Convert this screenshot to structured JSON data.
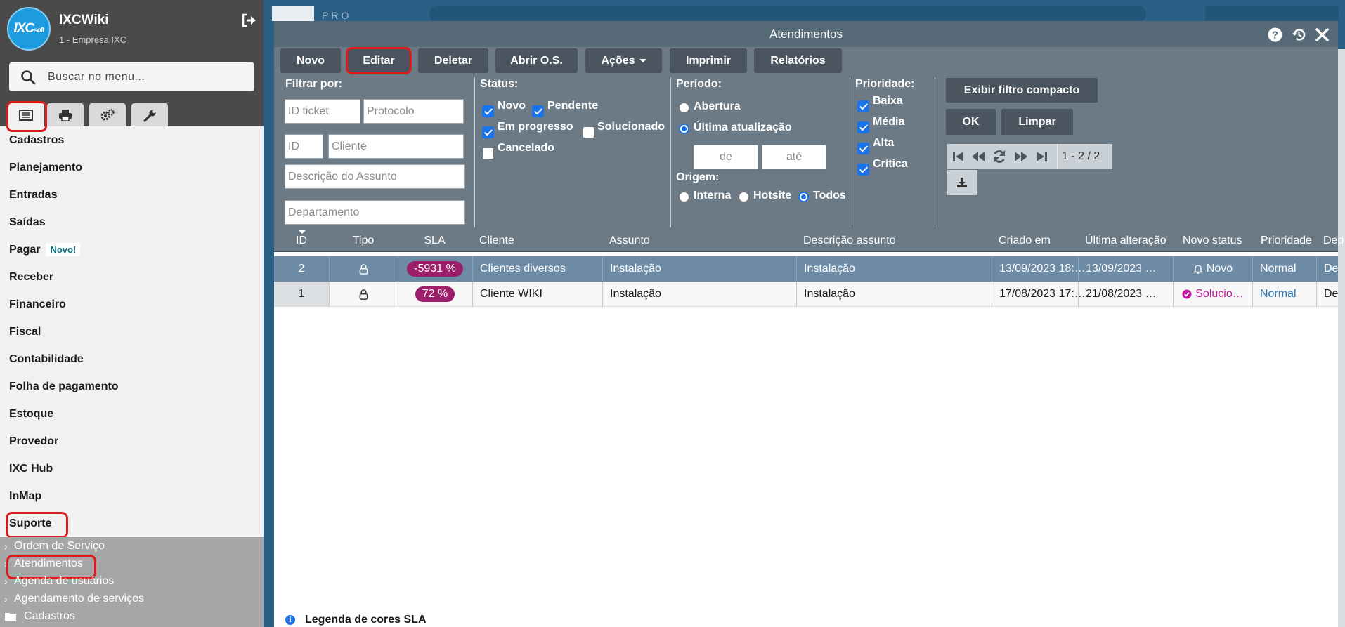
{
  "sidebar": {
    "app_name": "IXCWiki",
    "company": "1 - Empresa IXC",
    "logo_text": "IXC",
    "logo_sub": "soft",
    "search_placeholder": "Buscar no menu...",
    "menu": [
      {
        "label": "Cadastros"
      },
      {
        "label": "Planejamento"
      },
      {
        "label": "Entradas"
      },
      {
        "label": "Saídas"
      },
      {
        "label": "Pagar",
        "badge": "Novo!"
      },
      {
        "label": "Receber"
      },
      {
        "label": "Financeiro"
      },
      {
        "label": "Fiscal"
      },
      {
        "label": "Contabilidade"
      },
      {
        "label": "Folha de pagamento"
      },
      {
        "label": "Estoque"
      },
      {
        "label": "Provedor"
      },
      {
        "label": "IXC Hub"
      },
      {
        "label": "InMap"
      },
      {
        "label": "Suporte"
      }
    ],
    "submenu": [
      {
        "label": "Ordem de Serviço"
      },
      {
        "label": "Atendimentos"
      },
      {
        "label": "Agenda de usuários"
      },
      {
        "label": "Agendamento de serviços"
      },
      {
        "label": "Cadastros"
      }
    ]
  },
  "background": {
    "tab_text": "PRO"
  },
  "window": {
    "title": "Atendimentos",
    "toolbar": {
      "novo": "Novo",
      "editar": "Editar",
      "deletar": "Deletar",
      "abrir_os": "Abrir O.S.",
      "acoes": "Ações",
      "imprimir": "Imprimir",
      "relatorios": "Relatórios"
    },
    "filters": {
      "filtrar_por": "Filtrar por:",
      "id_ticket_ph": "ID ticket",
      "protocolo_ph": "Protocolo",
      "id_ph": "ID",
      "cliente_ph": "Cliente",
      "descricao_ph": "Descrição do Assunto",
      "departamento_ph": "Departamento",
      "status_label": "Status:",
      "status_novo": "Novo",
      "status_pendente": "Pendente",
      "status_em_progresso": "Em progresso",
      "status_solucionado": "Solucionado",
      "status_cancelado": "Cancelado",
      "periodo_label": "Período:",
      "periodo_abertura": "Abertura",
      "periodo_ultima": "Última atualização",
      "de_ph": "de",
      "ate_ph": "até",
      "origem_label": "Origem:",
      "origem_interna": "Interna",
      "origem_hotsite": "Hotsite",
      "origem_todos": "Todos",
      "prioridade_label": "Prioridade:",
      "prio_baixa": "Baixa",
      "prio_media": "Média",
      "prio_alta": "Alta",
      "prio_critica": "Crítica",
      "exibir_compacto": "Exibir filtro compacto",
      "ok": "OK",
      "limpar": "Limpar",
      "pager_text": "1 - 2 / 2"
    },
    "table": {
      "headers": {
        "id": "ID",
        "tipo": "Tipo",
        "sla": "SLA",
        "cliente": "Cliente",
        "assunto": "Assunto",
        "descricao": "Descrição assunto",
        "criado": "Criado em",
        "ultima": "Última alteração",
        "novo_status": "Novo status",
        "prioridade": "Prioridade",
        "dep": "Dep"
      },
      "rows": [
        {
          "id": "2",
          "sla": "-5931 %",
          "cliente": "Clientes diversos",
          "assunto": "Instalação",
          "descricao": "Instalação",
          "criado": "13/09/2023 18:…",
          "ultima": "13/09/2023 …",
          "status": "Novo",
          "prioridade": "Normal",
          "dep": "Dep"
        },
        {
          "id": "1",
          "sla": "72 %",
          "cliente": "Cliente WIKI",
          "assunto": "Instalação",
          "descricao": "Instalação",
          "criado": "17/08/2023 17:…",
          "ultima": "21/08/2023 …",
          "status": "Solucio…",
          "prioridade": "Normal",
          "dep": "Dep"
        }
      ]
    },
    "legend": "Legenda de cores SLA"
  }
}
